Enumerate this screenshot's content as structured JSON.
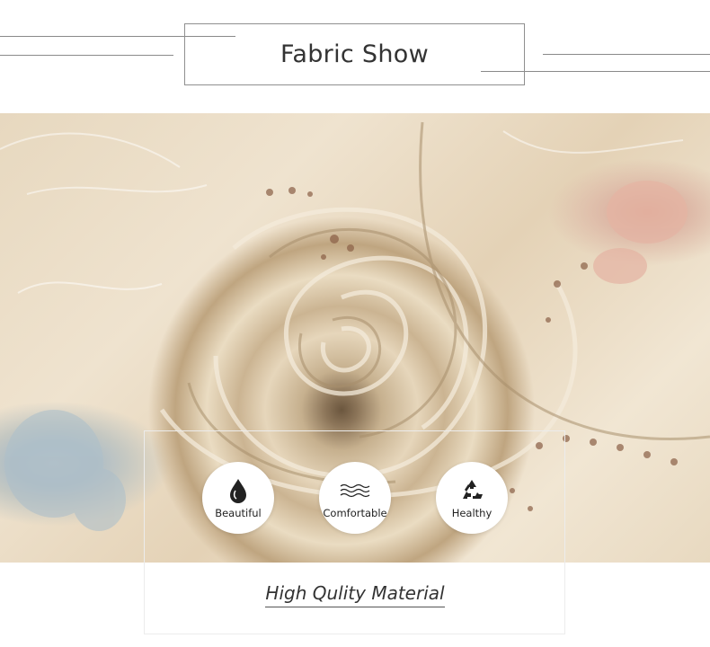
{
  "header": {
    "title": "Fabric Show"
  },
  "features": [
    {
      "label": "Beautiful",
      "icon": "water-drop-icon"
    },
    {
      "label": "Comfortable",
      "icon": "waves-icon"
    },
    {
      "label": "Healthy",
      "icon": "recycle-icon"
    }
  ],
  "tagline": "High Qulity Material",
  "colors": {
    "text": "#333333",
    "frame": "#8f8f8f",
    "fabric": "#e7d8bf"
  }
}
